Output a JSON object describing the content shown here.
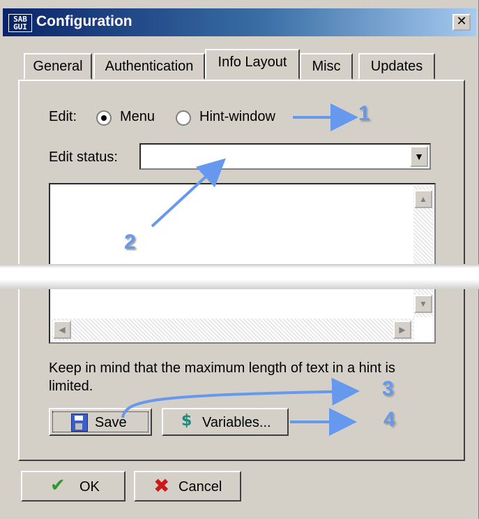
{
  "window": {
    "title": "Configuration",
    "icon_text_top": "SAB",
    "icon_text_bottom": "GUI",
    "close_glyph": "✕"
  },
  "tabs": [
    {
      "label": "General",
      "active": false
    },
    {
      "label": "Authentication",
      "active": false
    },
    {
      "label": "Info Layout",
      "active": true
    },
    {
      "label": "Misc",
      "active": false
    },
    {
      "label": "Updates",
      "active": false
    }
  ],
  "edit": {
    "label": "Edit:",
    "options": [
      {
        "label": "Menu",
        "selected": true
      },
      {
        "label": "Hint-window",
        "selected": false
      }
    ]
  },
  "edit_status": {
    "label": "Edit status:",
    "value": ""
  },
  "note": "Keep in mind that the maximum length of text in a hint is limited.",
  "buttons": {
    "save": "Save",
    "variables": "Variables...",
    "ok": "OK",
    "cancel": "Cancel"
  },
  "icons": {
    "save": "floppy-disk-icon",
    "variables": "dollar-icon",
    "ok": "checkmark-icon",
    "cancel": "red-x-icon"
  },
  "annotations": [
    "1",
    "2",
    "3",
    "4"
  ],
  "colors": {
    "title_start": "#0a246a",
    "annotation": "#6699ee",
    "face": "#d4d0c8"
  }
}
